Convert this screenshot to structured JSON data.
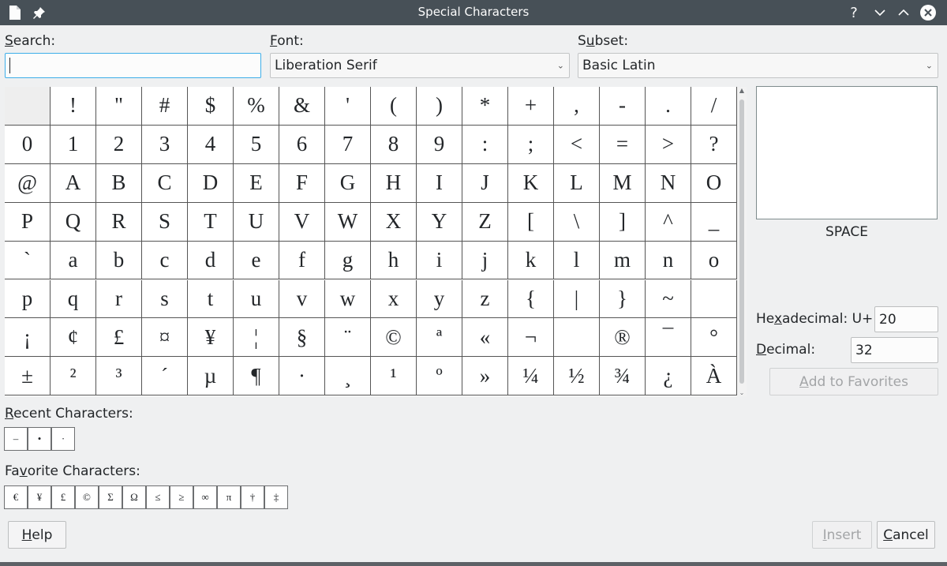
{
  "window": {
    "title": "Special Characters"
  },
  "search": {
    "label_pre": "",
    "label_u": "S",
    "label_post": "earch:",
    "value": ""
  },
  "font": {
    "label_pre": "",
    "label_u": "F",
    "label_post": "ont:",
    "value": "Liberation Serif"
  },
  "subset": {
    "label_pre": "S",
    "label_u": "u",
    "label_post": "bset:",
    "value": "Basic Latin"
  },
  "grid": {
    "rows": [
      [
        " ",
        "!",
        "\"",
        "#",
        "$",
        "%",
        "&",
        "'",
        "(",
        ")",
        "*",
        "+",
        ",",
        "-",
        ".",
        "/"
      ],
      [
        "0",
        "1",
        "2",
        "3",
        "4",
        "5",
        "6",
        "7",
        "8",
        "9",
        ":",
        ";",
        "<",
        "=",
        ">",
        "?"
      ],
      [
        "@",
        "A",
        "B",
        "C",
        "D",
        "E",
        "F",
        "G",
        "H",
        "I",
        "J",
        "K",
        "L",
        "M",
        "N",
        "O"
      ],
      [
        "P",
        "Q",
        "R",
        "S",
        "T",
        "U",
        "V",
        "W",
        "X",
        "Y",
        "Z",
        "[",
        "\\",
        "]",
        "^",
        "_"
      ],
      [
        "`",
        "a",
        "b",
        "c",
        "d",
        "e",
        "f",
        "g",
        "h",
        "i",
        "j",
        "k",
        "l",
        "m",
        "n",
        "o"
      ],
      [
        "p",
        "q",
        "r",
        "s",
        "t",
        "u",
        "v",
        "w",
        "x",
        "y",
        "z",
        "{",
        "|",
        "}",
        "~",
        ""
      ],
      [
        "¡",
        "¢",
        "£",
        "¤",
        "¥",
        "¦",
        "§",
        "¨",
        "©",
        "ª",
        "«",
        "¬",
        "",
        "®",
        "¯",
        "°"
      ],
      [
        "±",
        "²",
        "³",
        "´",
        "µ",
        "¶",
        "·",
        "¸",
        "¹",
        "º",
        "»",
        "¼",
        "½",
        "¾",
        "¿",
        "À"
      ]
    ]
  },
  "preview": {
    "char": " ",
    "name": "SPACE"
  },
  "hex": {
    "label_pre": "He",
    "label_u": "x",
    "label_post": "adecimal:",
    "prefix": "U+",
    "value": "20"
  },
  "decimal": {
    "label_pre": "",
    "label_u": "D",
    "label_post": "ecimal:",
    "value": "32"
  },
  "buttons": {
    "add_fav": {
      "pre": "",
      "u": "A",
      "post": "dd to Favorites"
    },
    "help": {
      "pre": "",
      "u": "H",
      "post": "elp"
    },
    "insert": {
      "pre": "",
      "u": "I",
      "post": "nsert"
    },
    "cancel": {
      "pre": "",
      "u": "C",
      "post": "ancel"
    }
  },
  "recent": {
    "label_pre": "",
    "label_u": "R",
    "label_post": "ecent Characters:",
    "chars": [
      "–",
      "•",
      "·"
    ]
  },
  "favorites": {
    "label_pre": "Fa",
    "label_u": "v",
    "label_post": "orite Characters:",
    "chars": [
      "€",
      "¥",
      "£",
      "©",
      "Σ",
      "Ω",
      "≤",
      "≥",
      "∞",
      "π",
      "†",
      "‡"
    ]
  },
  "colors": {
    "titlebar": "#475057",
    "window_bg": "#eff0f1",
    "grid_bg": "#ffffff",
    "grid_line": "#555555"
  }
}
